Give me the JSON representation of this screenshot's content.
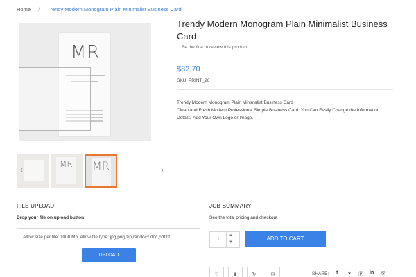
{
  "breadcrumb": {
    "home": "Home",
    "current": "Trendy Modern Monogram Plain Minimalist Business Card"
  },
  "product": {
    "title": "Trendy Modern Monogram Plain Minimalist Business Card",
    "review_link": "Be the first to review this product",
    "price": "$32.70",
    "sku": "SKU:  PRINT_26",
    "description_title": "Trendy Modern Monogram Plain Minimalist Business Card",
    "description_body": "Clean and Fresh Modern Professional Simple Business Card. You Can Easily Change the Information Details, Add Your Own Logo or Image."
  },
  "gallery": {
    "monogram": "MR",
    "prev_icon": "chevron-left-icon",
    "next_icon": "chevron-right-icon",
    "active_thumb_border": "#e8782f"
  },
  "upload": {
    "title": "FILE UPLOAD",
    "subtitle": "Drop your file on upload button",
    "note": "Allow size per file: 1000 Mb. Allow file type: jpg,png,zip,rar.docx,doc,pdf,tif",
    "button": "UPLOAD"
  },
  "summary": {
    "title": "JOB SUMMARY",
    "subtitle": "See the total pricing and checkout",
    "quantity": "1",
    "add_to_cart": "ADD TO CART"
  },
  "share": {
    "label": "SHARE:",
    "icons": [
      "facebook-icon",
      "twitter-icon",
      "pinterest-icon",
      "linkedin-icon",
      "email-icon"
    ]
  },
  "colors": {
    "accent": "#3b82e6",
    "link": "#3b7fd8"
  }
}
